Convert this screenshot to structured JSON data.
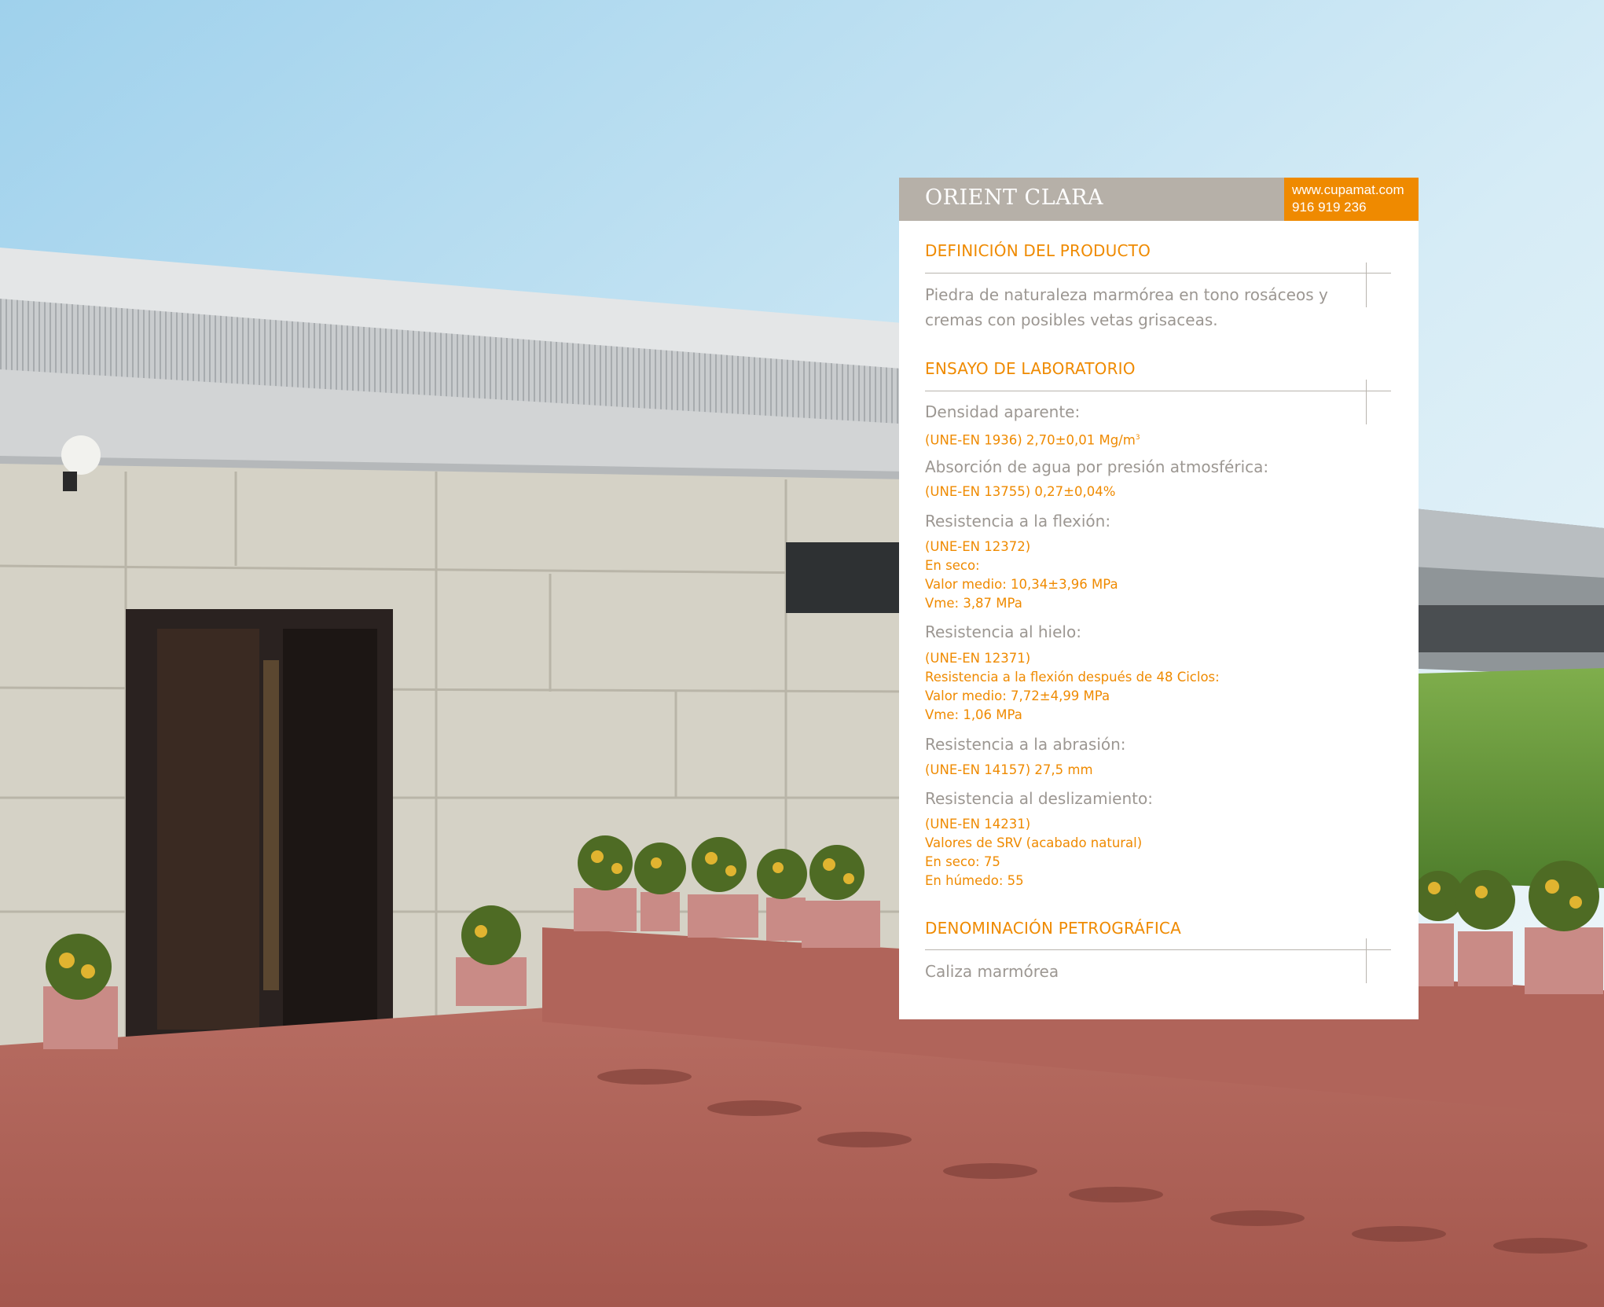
{
  "product": {
    "name": "ORIENT CLARA",
    "contact_web": "www.cupamat.com",
    "contact_phone": "916 919 236"
  },
  "definicion": {
    "title": "DEFINICIÓN DEL PRODUCTO",
    "line1": "Piedra de naturaleza marmórea en tono rosáceos y",
    "line2": "cremas con posibles vetas grisaceas."
  },
  "ensayo": {
    "title": "ENSAYO DE LABORATORIO",
    "densidad_label": "Densidad aparente:",
    "densidad_value": "(UNE-EN 1936) 2,70±0,01 Mg/m",
    "densidad_sup": "3",
    "absorcion_label": "Absorción de agua por presión atmosférica:",
    "absorcion_value": "(UNE-EN 13755) 0,27±0,04%",
    "flexion_label": "Resistencia a la flexión:",
    "flexion_lines": [
      "(UNE-EN 12372)",
      "En seco:",
      "Valor medio: 10,34±3,96 MPa",
      "Vme: 3,87 MPa"
    ],
    "hielo_label": "Resistencia al hielo:",
    "hielo_lines": [
      "(UNE-EN 12371)",
      "Resistencia a la flexión después de 48 Ciclos:",
      "Valor medio: 7,72±4,99 MPa",
      "Vme: 1,06 MPa"
    ],
    "abrasion_label": "Resistencia a la abrasión:",
    "abrasion_value": "(UNE-EN 14157) 27,5 mm",
    "deslizamiento_label": "Resistencia al deslizamiento:",
    "deslizamiento_lines": [
      "(UNE-EN 14231)",
      "Valores de SRV (acabado natural)",
      "En seco: 75",
      "En húmedo: 55"
    ]
  },
  "petrografica": {
    "title": "DENOMINACIÓN PETROGRÁFICA",
    "value": "Caliza marmórea"
  },
  "colors": {
    "accent": "#ef8a00",
    "header_gray": "#b6b0a8",
    "text_gray": "#9c9792"
  }
}
